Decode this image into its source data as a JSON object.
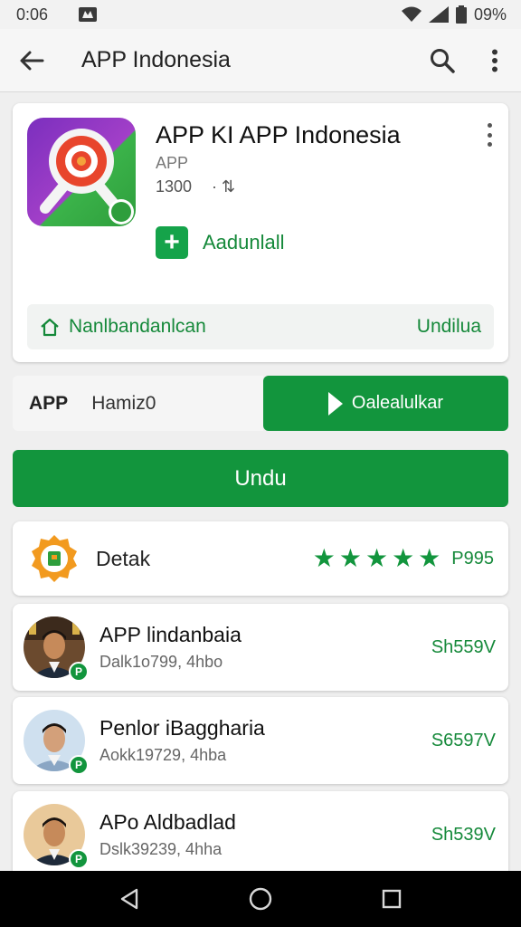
{
  "status": {
    "time": "0:06",
    "battery": "09%"
  },
  "appbar": {
    "title": "APP Indonesia"
  },
  "app": {
    "name": "APP KI APP Indonesia",
    "subtitle": "APP",
    "meta_count": "1300",
    "meta_extra": "· ⇅",
    "add_label": "Aadunlall",
    "nav_label": "Nanlbandanlcan",
    "nav_right": "Undilua"
  },
  "install": {
    "label": "APP",
    "value": "Hamiz0",
    "play_label": "Oalealulkar"
  },
  "primary_button": {
    "label": "Undu"
  },
  "rating": {
    "label": "Detak",
    "stars": 5,
    "value": "P995"
  },
  "list": [
    {
      "title": "APP lindanbaia",
      "subtitle": "Dalk1o799, 4hbo",
      "price": "Sh559V",
      "badge": "P"
    },
    {
      "title": "Penlor iBaggharia",
      "subtitle": "Aokk19729, 4hba",
      "price": "S6597V",
      "badge": "P"
    },
    {
      "title": "APo Aldbadlad",
      "subtitle": "Dslk39239, 4hha",
      "price": "Sh539V",
      "badge": "P"
    }
  ],
  "colors": {
    "accent": "#12953d",
    "accent_text": "#15893a"
  },
  "icons": [
    "back-arrow-icon",
    "search-icon",
    "more-vert-icon",
    "plus-icon",
    "home-icon",
    "play-icon",
    "star-icon",
    "nav-back-icon",
    "nav-home-icon",
    "nav-recents-icon"
  ]
}
